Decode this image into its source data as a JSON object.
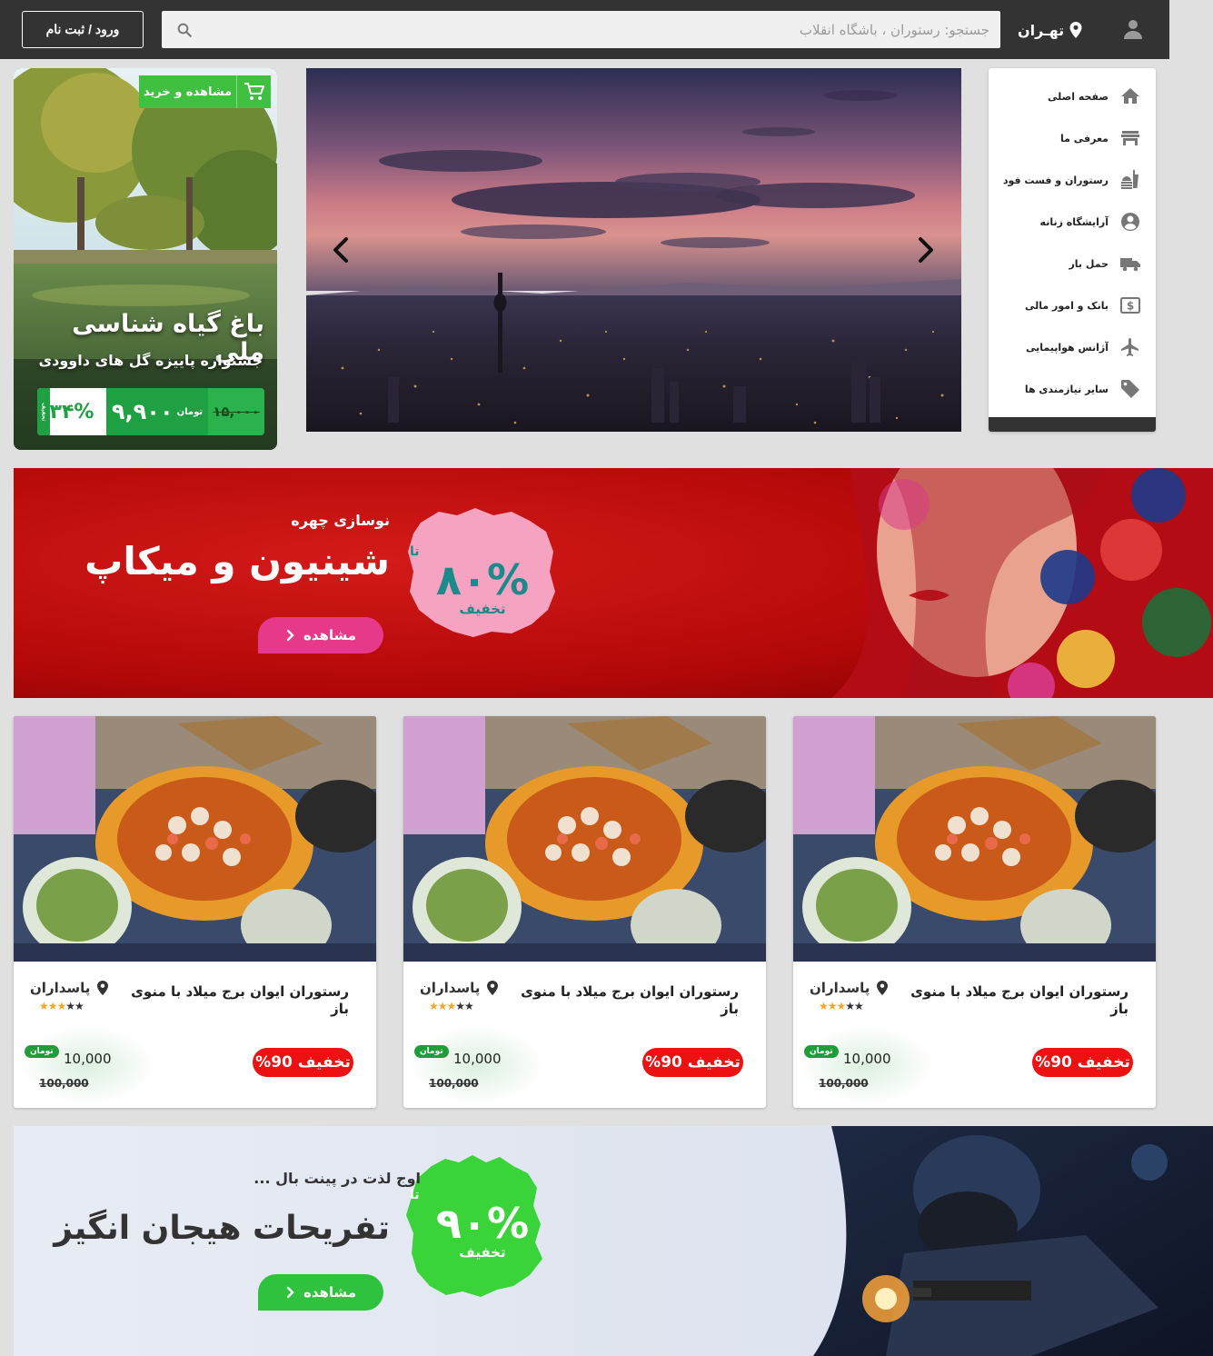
{
  "header": {
    "login_label": "ورود / ثبت نام",
    "search_placeholder": "جستجو: رستوران ، باشگاه انقلاب",
    "city": "تهـران"
  },
  "sidebar": {
    "items": [
      {
        "label": "صفحه اصلی",
        "icon": "home-icon"
      },
      {
        "label": "معرفی ما",
        "icon": "store-icon"
      },
      {
        "label": "رستوران و فست فود",
        "icon": "fastfood-icon"
      },
      {
        "label": "آرایشگاه زنانه",
        "icon": "face-icon"
      },
      {
        "label": "حمل بار",
        "icon": "truck-icon"
      },
      {
        "label": "بانک و امور مالی",
        "icon": "money-icon"
      },
      {
        "label": "آژانس هواپیمایی",
        "icon": "airplane-icon"
      },
      {
        "label": "سایر نیازمندی ها",
        "icon": "tag-icon"
      }
    ]
  },
  "promo": {
    "cta": "مشاهده و خرید",
    "title": "باغ گیاه شناسی ملی",
    "subtitle": "جشنواره پاییزه گل های داوودی",
    "old_price": "۱۵,۰۰۰",
    "new_price": "۹,۹۰۰",
    "currency": "تومان",
    "discount": "۳۴%",
    "discount_tag": "تخفیف"
  },
  "banner1": {
    "small": "نوسازی چهره",
    "big": "شینیون و میکاپ",
    "upto": "تا",
    "percent": "۸۰%",
    "off": "تخفیف",
    "button": "مشاهده"
  },
  "cards": [
    {
      "title": "رستوران ایوان برج میلاد با منوی باز",
      "location": "پاسداران",
      "stars": 3,
      "currency": "تومان",
      "price": "10,000",
      "old_price": "100,000",
      "discount": "تخفیف 90%"
    },
    {
      "title": "رستوران ایوان برج میلاد با منوی باز",
      "location": "پاسداران",
      "stars": 3,
      "currency": "تومان",
      "price": "10,000",
      "old_price": "100,000",
      "discount": "تخفیف 90%"
    },
    {
      "title": "رستوران ایوان برج میلاد با منوی باز",
      "location": "پاسداران",
      "stars": 3,
      "currency": "تومان",
      "price": "10,000",
      "old_price": "100,000",
      "discount": "تخفیف 90%"
    }
  ],
  "banner2": {
    "small": "اوج لذت در پینت بال ...",
    "big": "تفریحات هیجان انگیز",
    "upto": "تا",
    "percent": "۹۰%",
    "off": "تخفیف",
    "button": "مشاهده"
  },
  "colors": {
    "header_bg": "#333333",
    "page_bg": "#e0e0e0",
    "discount_red": "#ee1111",
    "green": "#1f9d3a",
    "banner_red": "#c60a0a",
    "banner_pink": "#f5a3c0"
  }
}
